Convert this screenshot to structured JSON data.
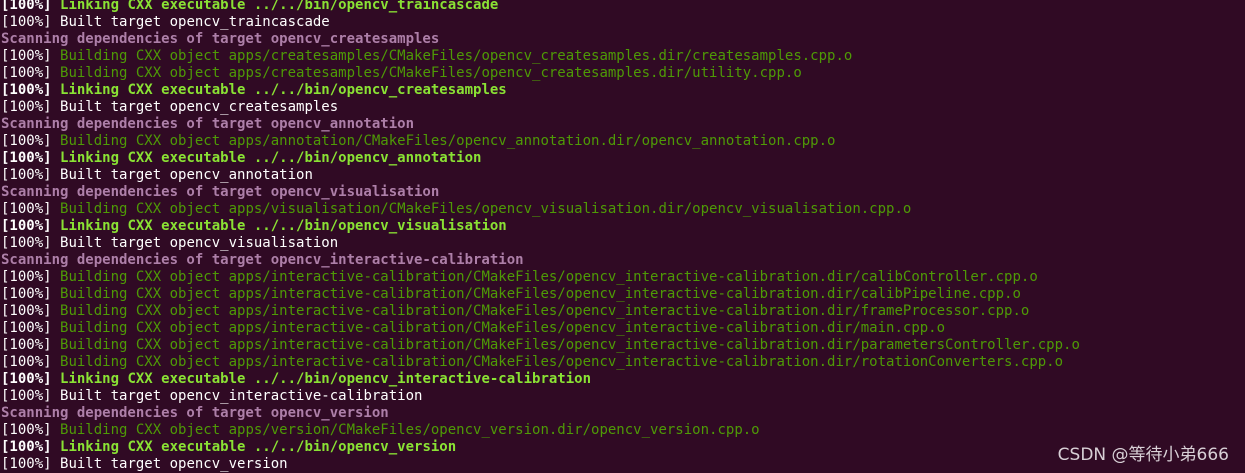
{
  "colors": {
    "background": "#300a24",
    "building": "#4e9a06",
    "linking": "#8ae234",
    "scanning": "#ad7fa8",
    "built": "#ffffff"
  },
  "lines": [
    {
      "kind": "linking",
      "prefix": "[100%] ",
      "text": "Linking CXX executable ../../bin/opencv_traincascade"
    },
    {
      "kind": "built",
      "prefix": "[100%] ",
      "text": "Built target opencv_traincascade"
    },
    {
      "kind": "scanning",
      "prefix": "",
      "text": "Scanning dependencies of target opencv_createsamples"
    },
    {
      "kind": "building",
      "prefix": "[100%] ",
      "text": "Building CXX object apps/createsamples/CMakeFiles/opencv_createsamples.dir/createsamples.cpp.o"
    },
    {
      "kind": "building",
      "prefix": "[100%] ",
      "text": "Building CXX object apps/createsamples/CMakeFiles/opencv_createsamples.dir/utility.cpp.o"
    },
    {
      "kind": "linking",
      "prefix": "[100%] ",
      "text": "Linking CXX executable ../../bin/opencv_createsamples"
    },
    {
      "kind": "built",
      "prefix": "[100%] ",
      "text": "Built target opencv_createsamples"
    },
    {
      "kind": "scanning",
      "prefix": "",
      "text": "Scanning dependencies of target opencv_annotation"
    },
    {
      "kind": "building",
      "prefix": "[100%] ",
      "text": "Building CXX object apps/annotation/CMakeFiles/opencv_annotation.dir/opencv_annotation.cpp.o"
    },
    {
      "kind": "linking",
      "prefix": "[100%] ",
      "text": "Linking CXX executable ../../bin/opencv_annotation"
    },
    {
      "kind": "built",
      "prefix": "[100%] ",
      "text": "Built target opencv_annotation"
    },
    {
      "kind": "scanning",
      "prefix": "",
      "text": "Scanning dependencies of target opencv_visualisation"
    },
    {
      "kind": "building",
      "prefix": "[100%] ",
      "text": "Building CXX object apps/visualisation/CMakeFiles/opencv_visualisation.dir/opencv_visualisation.cpp.o"
    },
    {
      "kind": "linking",
      "prefix": "[100%] ",
      "text": "Linking CXX executable ../../bin/opencv_visualisation"
    },
    {
      "kind": "built",
      "prefix": "[100%] ",
      "text": "Built target opencv_visualisation"
    },
    {
      "kind": "scanning",
      "prefix": "",
      "text": "Scanning dependencies of target opencv_interactive-calibration"
    },
    {
      "kind": "building",
      "prefix": "[100%] ",
      "text": "Building CXX object apps/interactive-calibration/CMakeFiles/opencv_interactive-calibration.dir/calibController.cpp.o"
    },
    {
      "kind": "building",
      "prefix": "[100%] ",
      "text": "Building CXX object apps/interactive-calibration/CMakeFiles/opencv_interactive-calibration.dir/calibPipeline.cpp.o"
    },
    {
      "kind": "building",
      "prefix": "[100%] ",
      "text": "Building CXX object apps/interactive-calibration/CMakeFiles/opencv_interactive-calibration.dir/frameProcessor.cpp.o"
    },
    {
      "kind": "building",
      "prefix": "[100%] ",
      "text": "Building CXX object apps/interactive-calibration/CMakeFiles/opencv_interactive-calibration.dir/main.cpp.o"
    },
    {
      "kind": "building",
      "prefix": "[100%] ",
      "text": "Building CXX object apps/interactive-calibration/CMakeFiles/opencv_interactive-calibration.dir/parametersController.cpp.o"
    },
    {
      "kind": "building",
      "prefix": "[100%] ",
      "text": "Building CXX object apps/interactive-calibration/CMakeFiles/opencv_interactive-calibration.dir/rotationConverters.cpp.o"
    },
    {
      "kind": "linking",
      "prefix": "[100%] ",
      "text": "Linking CXX executable ../../bin/opencv_interactive-calibration"
    },
    {
      "kind": "built",
      "prefix": "[100%] ",
      "text": "Built target opencv_interactive-calibration"
    },
    {
      "kind": "scanning",
      "prefix": "",
      "text": "Scanning dependencies of target opencv_version"
    },
    {
      "kind": "building",
      "prefix": "[100%] ",
      "text": "Building CXX object apps/version/CMakeFiles/opencv_version.dir/opencv_version.cpp.o"
    },
    {
      "kind": "linking",
      "prefix": "[100%] ",
      "text": "Linking CXX executable ../../bin/opencv_version"
    },
    {
      "kind": "built",
      "prefix": "[100%] ",
      "text": "Built target opencv_version"
    }
  ],
  "watermark": "CSDN @等待小弟666"
}
